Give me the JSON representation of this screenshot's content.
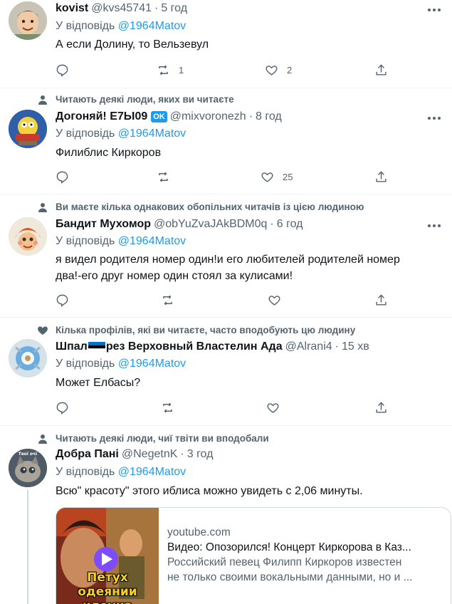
{
  "tweets": [
    {
      "name": "kovist",
      "handle": "@kvs45741",
      "dot": "·",
      "time": "5 год",
      "reply_prefix": "У відповідь",
      "reply_mention": "@1964Matov",
      "text": "А если  Долину, то Вельзевул",
      "retweets": "1",
      "likes": "2"
    },
    {
      "context": "Читають деякі люди, яких ви читаєте",
      "name": "Догоняй! E7Ы09",
      "badge": "OK",
      "handle": "@mixvoronezh",
      "dot": "·",
      "time": "8 год",
      "reply_prefix": "У відповідь",
      "reply_mention": "@1964Matov",
      "text": "Филиблис Киркоров",
      "retweets": "",
      "likes": "25"
    },
    {
      "context": "Ви маєте кілька однакових обопільних читачів із цією людиною",
      "name": "Бандит Мухомор",
      "handle": "@obYuZvaJAkBDM0q",
      "dot": "·",
      "time": "6 год",
      "reply_prefix": "У відповідь",
      "reply_mention": "@1964Matov",
      "text_line1": "я видел родителя номер один!и его любителей родителей номер",
      "text_line2": "два!-его друг номер один стоял за кулисами!",
      "retweets": "",
      "likes": ""
    },
    {
      "context": "Кілька профілів, які ви читаєте, часто вподобують цю людину",
      "name_part1": "Шпал",
      "name_part2": "рез Верховный Властелин Ада",
      "handle": "@Alrani4",
      "dot": "·",
      "time": "15 хв",
      "reply_prefix": "У відповідь",
      "reply_mention": "@1964Matov",
      "text": "Может Елбасы?",
      "retweets": "",
      "likes": ""
    },
    {
      "context": "Читають деякі люди, чиї твіти ви вподобали",
      "name": "Добра Пані",
      "handle": "@NegetnK",
      "dot": "·",
      "time": "3 год",
      "reply_prefix": "У відповідь",
      "reply_mention": "@1964Matov",
      "text": "Всю\" красоту\" этого иблиса можно увидеть с 2,06 минуты.",
      "avatar_caption": "Твої очі",
      "card": {
        "domain": "youtube.com",
        "title": "Видео: Опозорился! Концерт Киркорова в Каз...",
        "desc_line1": "Российский певец Филипп Киркоров известен",
        "desc_line2": "не только своими вокальными данными, но и ...",
        "thumb_line1": "Петух",
        "thumb_line2": "одеянии клоуна"
      }
    }
  ],
  "colors": {
    "text": "#0f1419",
    "secondary": "#536471",
    "link": "#1d9bf0",
    "divider": "#eff3f4"
  }
}
